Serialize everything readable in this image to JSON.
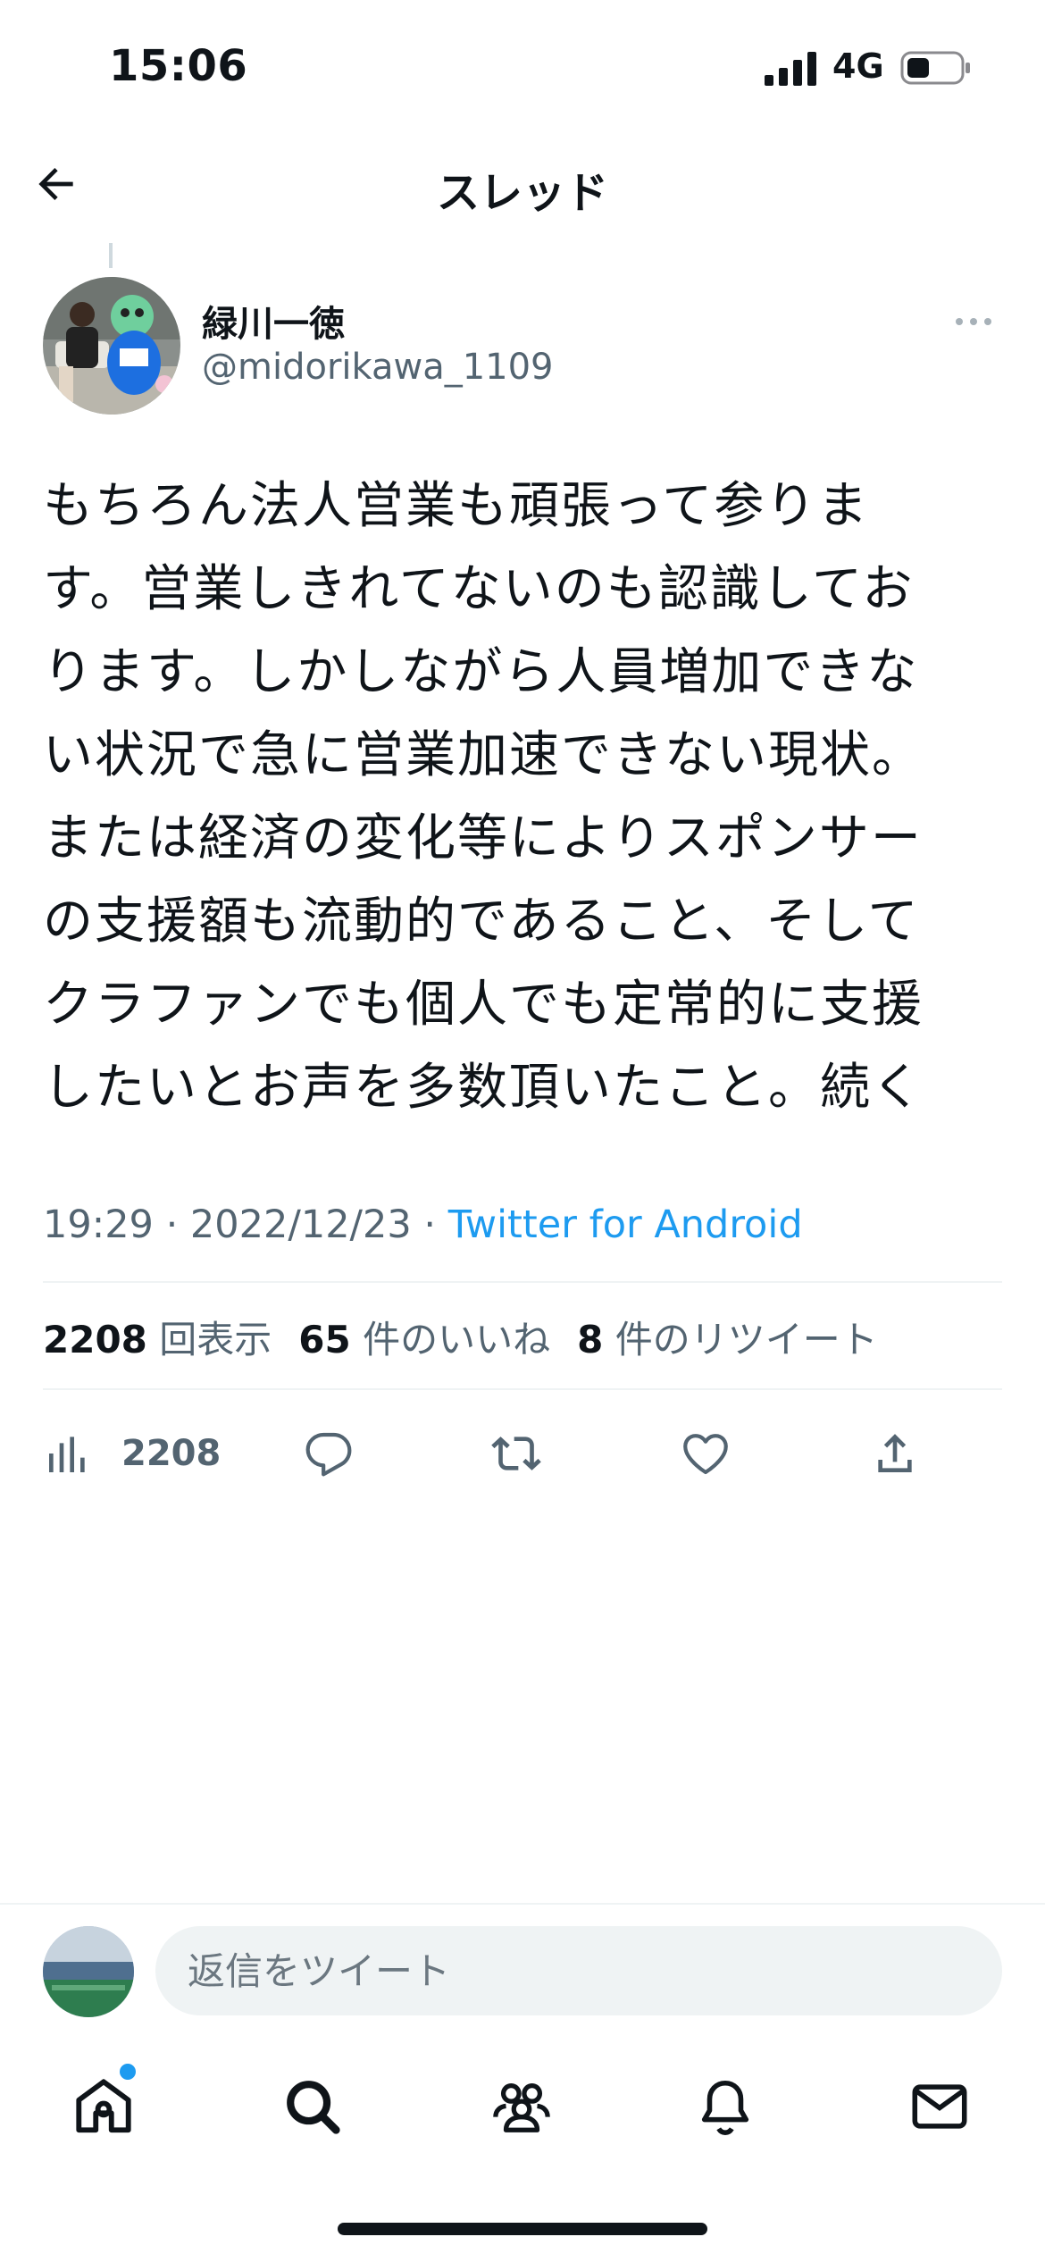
{
  "status_bar": {
    "time": "15:06",
    "network": "4G"
  },
  "header": {
    "title": "スレッド"
  },
  "tweet": {
    "author_name": "緑川一徳",
    "author_handle": "@midorikawa_1109",
    "lines": [
      "もちろん法人営業も頑張って参りま",
      "す。営業しきれてないのも認識してお",
      "ります。しかしながら人員増加できな",
      "い状況で急に営業加速できない現状。",
      "または経済の変化等によりスポンサー",
      "の支援額も流動的であること、そして",
      "クラファンでも個人でも定常的に支援",
      "したいとお声を多数頂いたこと。続く"
    ],
    "timestamp": "19:29 · 2022/12/23 · ",
    "source": "Twitter for Android",
    "stats": {
      "views": "2208",
      "views_label": "回表示",
      "likes": "65",
      "likes_label": "件のいいね",
      "retweets": "8",
      "retweets_label": "件のリツイート"
    },
    "actions": {
      "views_count": "2208"
    }
  },
  "reply": {
    "placeholder": "返信をツイート"
  },
  "nav": {
    "items": [
      "home-icon",
      "search-icon",
      "communities-icon",
      "notifications-icon",
      "messages-icon"
    ],
    "accent": "#1d9bf0"
  }
}
